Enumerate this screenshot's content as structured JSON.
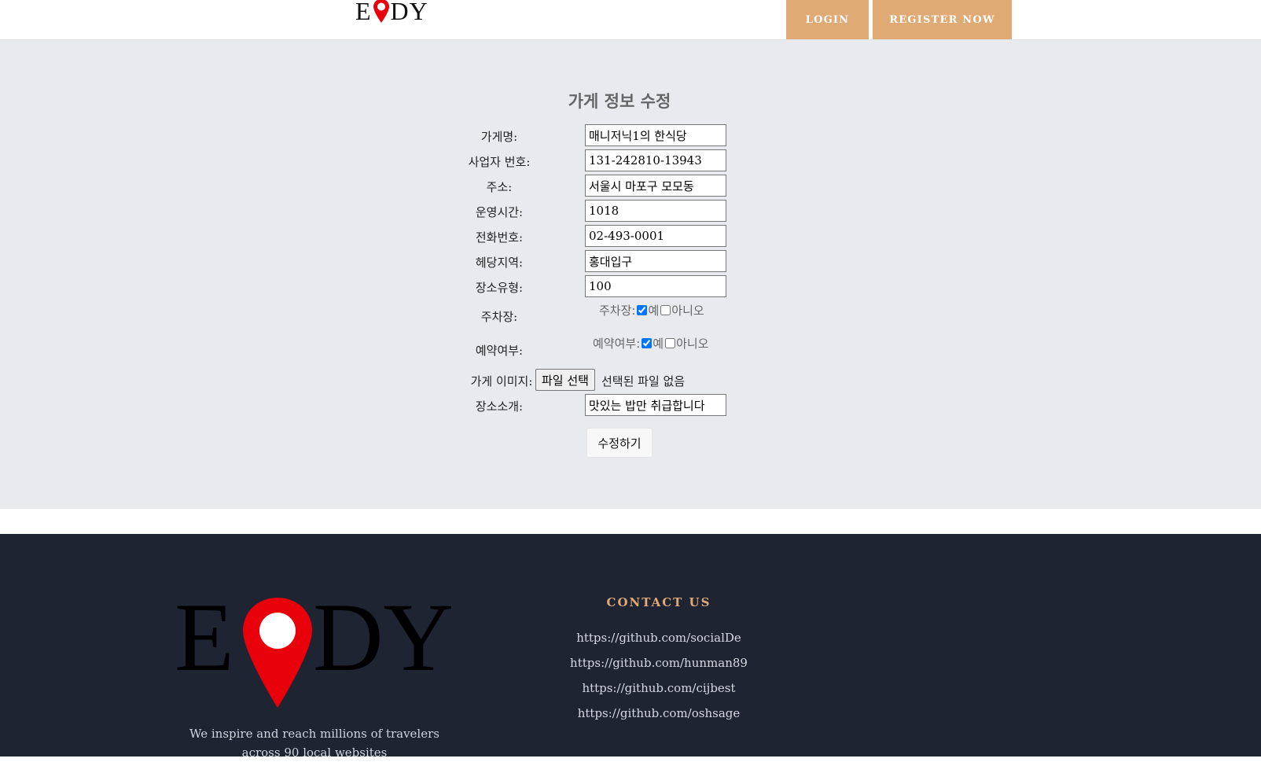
{
  "header": {
    "logo_text_left": "E",
    "logo_text_right": "DY",
    "login_label": "LOGIN",
    "register_label": "REGISTER NOW",
    "accent_color": "#e0aa74"
  },
  "form": {
    "title": "가게 정보 수정",
    "fields": [
      {
        "label": "가게명:",
        "value": "매니저닉1의 한식당"
      },
      {
        "label": "사업자 번호:",
        "value": "131-242810-13943"
      },
      {
        "label": "주소:",
        "value": "서울시 마포구 모모동"
      },
      {
        "label": "운영시간:",
        "value": "1018"
      },
      {
        "label": "전화번호:",
        "value": "02-493-0001"
      },
      {
        "label": "헤당지역:",
        "value": "홍대입구"
      },
      {
        "label": "장소유형:",
        "value": "100"
      }
    ],
    "parking": {
      "label": "주차장:",
      "inline_label": "주차장:",
      "yes_label": "예",
      "no_label": "아니오",
      "yes_checked": true,
      "no_checked": false
    },
    "reservation": {
      "label": "예약여부:",
      "inline_label": "예약여부:",
      "yes_label": "예",
      "no_label": "아니오",
      "yes_checked": true,
      "no_checked": false
    },
    "image": {
      "label": "가게 이미지:",
      "button_label": "파일 선택",
      "status": "선택된 파일 없음"
    },
    "intro": {
      "label": "장소소개:",
      "value": "맛있는 밥만 취급합니다"
    },
    "submit_label": "수정하기"
  },
  "footer": {
    "logo_text_left": "E",
    "logo_text_right": "DY",
    "tagline_line1": "We inspire and reach millions of travelers",
    "tagline_line2": "across 90 local websites",
    "contact_title": "CONTACT US",
    "links": [
      "https://github.com/socialDe",
      "https://github.com/hunman89",
      "https://github.com/cijbest",
      "https://github.com/oshsage"
    ],
    "background_color": "#1f2433",
    "pin_color": "#e8000b"
  }
}
